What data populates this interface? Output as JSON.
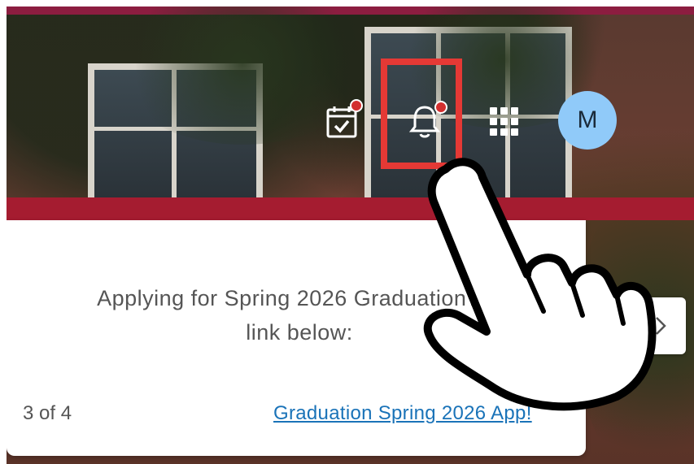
{
  "header": {
    "calendar_icon": "calendar-check-icon",
    "bell_icon": "bell-icon",
    "apps_icon": "grid-apps-icon",
    "avatar_initial": "M"
  },
  "announcement": {
    "message_line1": "Applying for Spring 2026 Graduation? C",
    "message_line2": "link below:",
    "counter": "3 of 4",
    "link_text": "Graduation Spring 2026 App!"
  },
  "colors": {
    "top_bar": "#8c1d40",
    "red_band": "#a51c30",
    "badge": "#d32f2f",
    "highlight": "#e53935",
    "avatar": "#90caf9",
    "link": "#1a73b8"
  }
}
